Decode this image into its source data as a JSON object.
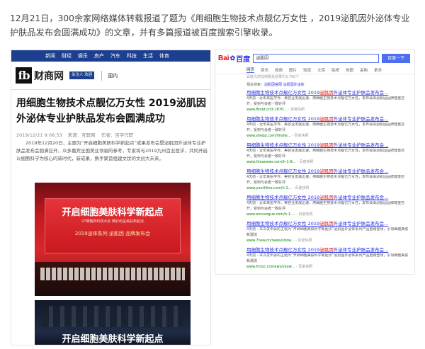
{
  "intro": "12月21日，300余家网络媒体转载报道了题为《用细胞生物技术点靓亿万女性 ，2019泌肌因外泌体专业护肤品发布会圆满成功》的文章，并有多篇报道被百度搜索引擎收录。",
  "left": {
    "nav": [
      "新闻",
      "财经",
      "娱乐",
      "房产",
      "汽车",
      "科技",
      "生活",
      "体育"
    ],
    "logo_mark": "fb",
    "logo_text": "财商网",
    "follow": "关注人 欢迎",
    "crumb": "国内",
    "title": "用细胞生物技术点靓亿万女性 2019泌肌因外泌体专业护肤品发布会圆满成功",
    "meta_date": "2019/12/21 9:08:53",
    "meta_source": "来源：互联网",
    "meta_author": "作者：百字作职",
    "body": "2019年12月20日，主题为“开启细胞美肤科学新起点”成果发布会暨泌肌因外泌体专业护肤品发布会圆满召开，众多嘉宾全国美业领袖的参考，专家将与2019九州百业医学，共同开启以细胞科学为核心的新时代，新成果，携手聚首组建文状的文创大未来。",
    "img1_big": "开启细胞美肤科学新起点",
    "img1_small": "VT细胞新科技大会 精彩纷呈美肤新起点",
    "img1_sub": "2019泌体系列·泌肌因 品牌发布会",
    "img2_big": "开启细胞美肤科学新起点"
  },
  "right": {
    "logo_a": "Bai",
    "logo_b": "百度",
    "query": "泌肌因",
    "search_btn": "百度一下",
    "tabs": [
      "网页",
      "资讯",
      "视频",
      "图片",
      "知道",
      "文库",
      "贴吧",
      "地图",
      "采购",
      "更多"
    ],
    "count": "百度为您找到相关结果约3,790个",
    "hint_prefix": "相关搜索：",
    "hint_link": "泌肌因官网",
    "hint_suffix": "   泌肌因外泌体",
    "results": [
      {
        "title_a": "用细胞生物技术点靓亿万女性 2019",
        "title_red": "泌肌因",
        "title_b": "外泌体专业护肤品发布会...",
        "snippet": "4天前 - 近年来医学界、美容业发展迅速，用细胞生物技术点靓亿万女性，发布会由泌肌因品牌隆重召开，受到与会者一致好评",
        "url": "www.fbnet.cn/t-1870...",
        "snap": " - 百度快照"
      },
      {
        "title_a": "用细胞生物技术点靓亿万女性 2019",
        "title_red": "泌肌因",
        "title_b": "外泌体专业护肤品发布会...",
        "snippet": "4天前 - 近年来医学界、美容业发展迅速，用细胞生物技术点靓亿万女性，发布会由泌肌因品牌隆重召开，受到与会者一致好评",
        "url": "www.shebp.com/hhshe...",
        "snap": " - 百度快照"
      },
      {
        "title_a": "用细胞生物技术点靓亿万女性 2019",
        "title_red": "泌肌因",
        "title_b": "外泌体专业护肤品发布会...",
        "snippet": "4天前 - 近年来医学界、美容业发展迅速，用细胞生物技术点靓亿万女性，发布会由泌肌因品牌隆重召开，受到与会者一致好评",
        "url": "www.theanews.com/h-1-9...",
        "snap": " - 百度快照"
      },
      {
        "title_a": "用细胞生物技术点靓亿万女性 2019",
        "title_red": "泌肌因",
        "title_b": "外泌体专业护肤品发布会...",
        "snippet": "4天前 - 近年来医学界、美容业发展迅速，用细胞生物技术点靓亿万女性，发布会由泌肌因品牌隆重召开，受到与会者一致好评",
        "url": "www.youthlive.com/h-1...",
        "snap": " - 百度快照"
      },
      {
        "title_a": "用细胞生物技术点靓亿万女性 2019",
        "title_red": "泌肌因",
        "title_b": "外泌体专业护肤品发布会...",
        "snippet": "4天前 - 近年来医学界、美容业发展迅速，用细胞生物技术点靓亿万女性，发布会由泌肌因品牌隆重召开，受到与会者一致好评",
        "url": "www.emuvogue.com/h-1-...",
        "snap": " - 百度快照"
      },
      {
        "title_a": "用细胞生物技术点靓亿万女性 2019",
        "title_red": "泌肌因",
        "title_b": "外泌体专业护肤品发布会...",
        "snippet": "4天前 - 本次发布会的主题为“开启细胞美肤科学新起点”泌肌因外泌体系列产品重磅登场，引领细胞美肤新潮流",
        "url": "www.7new.cn/news/show...",
        "snap": " - 百度快照"
      },
      {
        "title_a": "用细胞生物技术点靓亿万女性 2019",
        "title_red": "泌肌因",
        "title_b": "外泌体专业护肤品发布会...",
        "snippet": "4天前 - 本次发布会的主题为“开启细胞美肤科学新起点”泌肌因外泌体系列产品重磅登场，引领细胞美肤新潮流",
        "url": "www.hntzc.cn/news/show...",
        "snap": " - 百度快照"
      }
    ]
  }
}
